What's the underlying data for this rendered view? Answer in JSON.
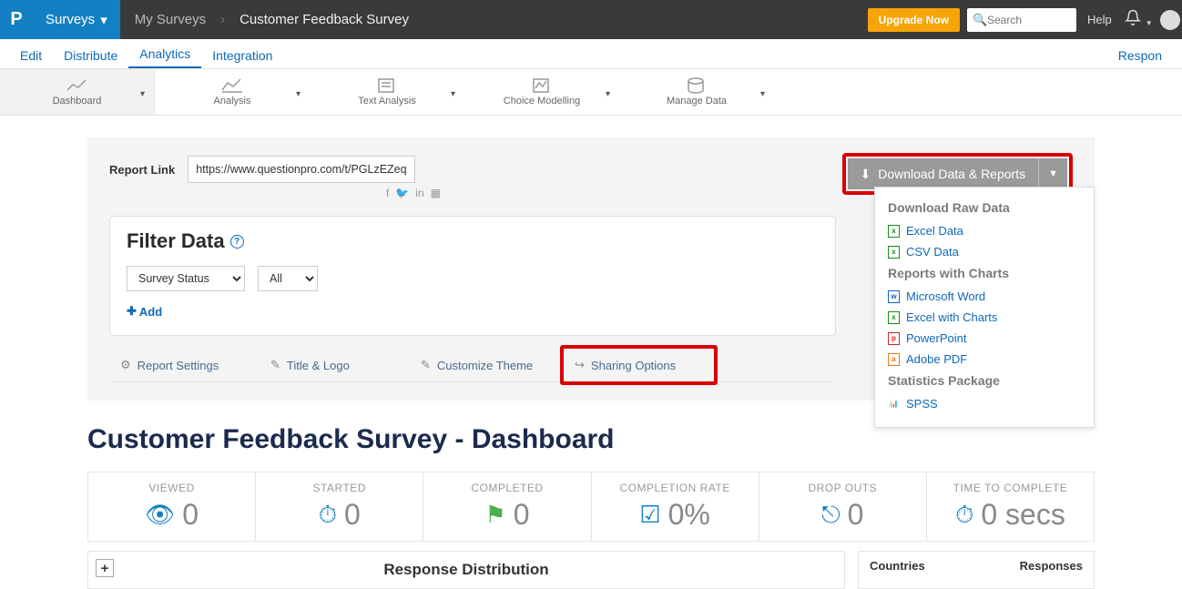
{
  "topbar": {
    "surveys_label": "Surveys",
    "breadcrumb1": "My Surveys",
    "breadcrumb2": "Customer Feedback Survey",
    "upgrade": "Upgrade Now",
    "search_placeholder": "Search",
    "help": "Help"
  },
  "tabs": {
    "edit": "Edit",
    "distribute": "Distribute",
    "analytics": "Analytics",
    "integration": "Integration",
    "respon": "Respon"
  },
  "ribbon": {
    "dashboard": "Dashboard",
    "analysis": "Analysis",
    "text_analysis": "Text Analysis",
    "choice_modelling": "Choice Modelling",
    "manage_data": "Manage Data"
  },
  "report_link": {
    "label": "Report Link",
    "value": "https://www.questionpro.com/t/PGLzEZeqE"
  },
  "download": {
    "btn": "Download Data & Reports",
    "h1": "Download Raw Data",
    "excel": "Excel Data",
    "csv": "CSV Data",
    "h2": "Reports with Charts",
    "word": "Microsoft Word",
    "excel_charts": "Excel with Charts",
    "ppt": "PowerPoint",
    "pdf": "Adobe PDF",
    "h3": "Statistics Package",
    "spss": "SPSS"
  },
  "filter": {
    "title": "Filter Data",
    "status": "Survey Status",
    "all": "All",
    "add": "Add"
  },
  "tabbtns": {
    "settings": "Report Settings",
    "title_logo": "Title & Logo",
    "theme": "Customize Theme",
    "sharing": "Sharing Options"
  },
  "dash_title": "Customer Feedback Survey - Dashboard",
  "stats": {
    "viewed_lbl": "VIEWED",
    "viewed": "0",
    "started_lbl": "STARTED",
    "started": "0",
    "completed_lbl": "COMPLETED",
    "completed": "0",
    "rate_lbl": "COMPLETION RATE",
    "rate": "0%",
    "dropouts_lbl": "DROP OUTS",
    "dropouts": "0",
    "time_lbl": "TIME TO COMPLETE",
    "time": "0 secs"
  },
  "dist": {
    "title": "Response Distribution",
    "countries": "Countries",
    "responses": "Responses"
  }
}
